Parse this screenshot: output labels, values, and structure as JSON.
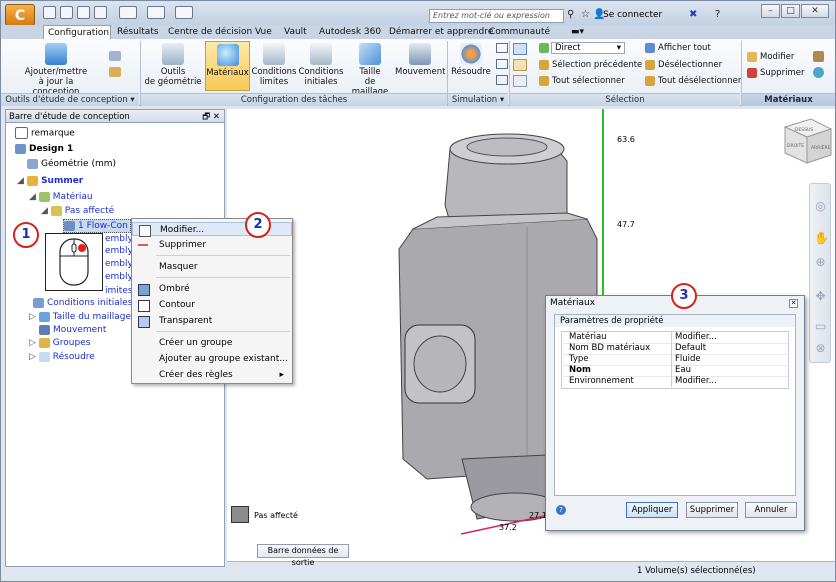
{
  "app": {
    "logo_letter": "C"
  },
  "titlebar": {
    "search_placeholder": "Entrez mot-clé ou expression",
    "signin_label": "Se connecter",
    "window_buttons": [
      "–",
      "□",
      "✕"
    ]
  },
  "tabs": [
    "Configuration",
    "Résultats",
    "Centre de décision",
    "Vue",
    "Vault",
    "Autodesk 360",
    "Démarrer et apprendre",
    "Communauté"
  ],
  "ribbon": {
    "panel1": {
      "add_update": "Ajouter/mettre\nà jour la conception",
      "label": "Outils d'étude de conception ▾"
    },
    "panel2": {
      "buttons": [
        "Outils\nde géométrie",
        "Matériaux",
        "Conditions\nlimites",
        "Conditions\ninitiales",
        "Taille\nde maillage",
        "Mouvement"
      ],
      "label": "Configuration des tâches"
    },
    "panel3": {
      "solve": "Résoudre",
      "label": "Simulation ▾"
    },
    "panel4": {
      "dropdown": "Direct",
      "items": [
        "Sélection précédente",
        "Tout sélectionner",
        "Afficher tout",
        "Désélectionner",
        "Tout désélectionner"
      ],
      "label": "Sélection"
    },
    "panel5": {
      "modify": "Modifier",
      "delete": "Supprimer",
      "label": "Matériaux"
    }
  },
  "leftpanel": {
    "title": "Barre d'étude de conception",
    "title_buttons": "🗗 ✕",
    "tree": {
      "remark": "remarque",
      "design": "Design 1",
      "geometry": "Géométrie  (mm)",
      "scenario": "Summer",
      "material": "Matériau",
      "unassigned": "Pas affecté",
      "flow": "1 Flow-Con",
      "items_hidden": [
        "embly",
        "embly",
        "embly",
        "embly",
        "imites"
      ],
      "initial_conditions": "Conditions initiales",
      "mesh_size": "Taille du maillage",
      "motion": "Mouvement",
      "groups": "Groupes",
      "solve": "Résoudre"
    }
  },
  "context_menu": {
    "items": [
      "Modifier...",
      "Supprimer",
      "Masquer",
      "Ombré",
      "Contour",
      "Transparent",
      "Créer un groupe",
      "Ajouter au groupe existant...",
      "Créer des règles"
    ]
  },
  "dialog": {
    "title": "Matériaux",
    "section": "Paramètres de propriété",
    "props": [
      {
        "key": "Matériau",
        "value": "Modifier..."
      },
      {
        "key": "Nom BD matériaux",
        "value": "Default"
      },
      {
        "key": "Type",
        "value": "Fluide"
      },
      {
        "key": "Nom",
        "value": "Eau"
      },
      {
        "key": "Environnement",
        "value": "Modifier..."
      }
    ],
    "buttons": {
      "apply": "Appliquer",
      "delete": "Supprimer",
      "cancel": "Annuler"
    }
  },
  "viewport": {
    "legend_label": "Pas affecté",
    "ruler_labels": [
      "63.6",
      "47.7",
      "37.2",
      "27.1"
    ],
    "viewcube_labels": [
      "DESSUS",
      "DROITE",
      "ARRIÈRE"
    ]
  },
  "statusbar": {
    "output_button": "Barre données de sortie",
    "status_text": "1 Volume(s) sélectionné(es)"
  },
  "callouts": [
    "1",
    "2",
    "3"
  ],
  "colors": {
    "accent": "#1a2fd0",
    "callout": "#d4231c",
    "ruler": "#22c51b"
  }
}
